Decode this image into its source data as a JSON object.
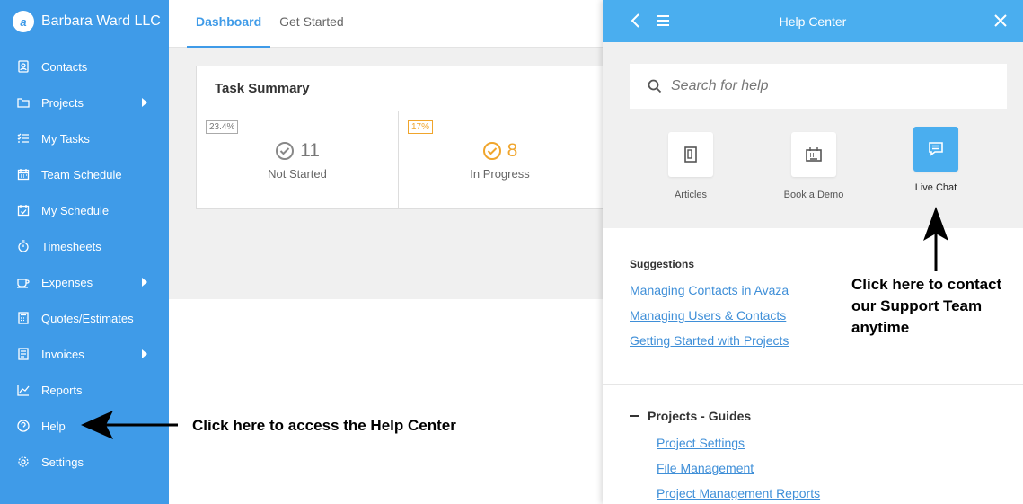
{
  "brand": {
    "logo_glyph": "a",
    "name": "Barbara Ward LLC"
  },
  "sidebar": {
    "items": [
      {
        "label": "Contacts",
        "icon": "contacts-icon",
        "has_submenu": false
      },
      {
        "label": "Projects",
        "icon": "folder-icon",
        "has_submenu": true
      },
      {
        "label": "My Tasks",
        "icon": "tasks-icon",
        "has_submenu": false
      },
      {
        "label": "Team Schedule",
        "icon": "calendar-icon",
        "has_submenu": false
      },
      {
        "label": "My Schedule",
        "icon": "calendar-check-icon",
        "has_submenu": false
      },
      {
        "label": "Timesheets",
        "icon": "stopwatch-icon",
        "has_submenu": false
      },
      {
        "label": "Expenses",
        "icon": "coffee-icon",
        "has_submenu": true
      },
      {
        "label": "Quotes/Estimates",
        "icon": "calculator-icon",
        "has_submenu": false
      },
      {
        "label": "Invoices",
        "icon": "invoice-icon",
        "has_submenu": true
      },
      {
        "label": "Reports",
        "icon": "chart-icon",
        "has_submenu": false
      },
      {
        "label": "Help",
        "icon": "help-icon",
        "has_submenu": false
      },
      {
        "label": "Settings",
        "icon": "gear-icon",
        "has_submenu": false
      }
    ]
  },
  "main": {
    "tabs": [
      {
        "label": "Dashboard",
        "active": true
      },
      {
        "label": "Get Started",
        "active": false
      }
    ],
    "task_summary": {
      "title": "Task Summary",
      "stats": [
        {
          "badge": "23.4%",
          "value": "11",
          "label": "Not Started",
          "color": "#888888"
        },
        {
          "badge": "17%",
          "value": "8",
          "label": "In Progress",
          "color": "#f0a52c"
        }
      ]
    }
  },
  "help_panel": {
    "title": "Help Center",
    "search_placeholder": "Search for help",
    "tiles": [
      {
        "label": "Articles",
        "icon": "article-icon",
        "accent": false
      },
      {
        "label": "Book a Demo",
        "icon": "demo-icon",
        "accent": false
      },
      {
        "label": "Live Chat",
        "icon": "chat-icon",
        "accent": true
      }
    ],
    "suggestions_title": "Suggestions",
    "suggestions": [
      "Managing Contacts in Avaza",
      "Managing Users & Contacts",
      "Getting Started with Projects"
    ],
    "guides_title": "Projects - Guides",
    "guides": [
      "Project Settings",
      "File Management",
      "Project Management Reports"
    ]
  },
  "annotations": {
    "help_center": "Click here to access the Help Center",
    "support_team": [
      "Click here to contact",
      "our Support Team",
      "anytime"
    ]
  },
  "colors": {
    "sidebar": "#3f9be8",
    "panel_header": "#4aaeef",
    "link": "#3f8fd8",
    "in_progress": "#f0a52c"
  }
}
